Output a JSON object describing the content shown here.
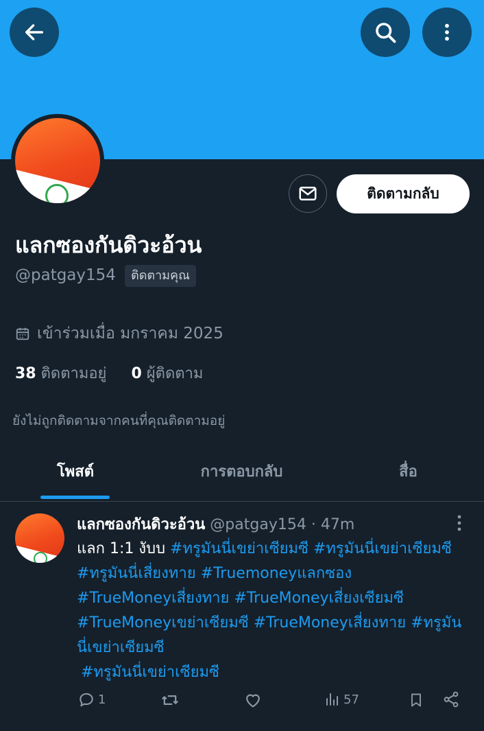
{
  "header": {
    "back": "back-arrow-icon",
    "search": "search-icon",
    "more": "more-vertical-icon"
  },
  "profile": {
    "display_name": "แลกซองกันดิวะอ้วน",
    "handle": "@patgay154",
    "follows_you_badge": "ติดตามคุณ",
    "joined": "เข้าร่วมเมื่อ มกราคม 2025",
    "following_count": "38",
    "following_label": "ติดตามอยู่",
    "followers_count": "0",
    "followers_label": "ผู้ติดตาม",
    "not_followed_note": "ยังไม่ถูกติดตามจากคนที่คุณติดตามอยู่",
    "follow_back_label": "ติดตามกลับ"
  },
  "tabs": [
    {
      "label": "โพสต์",
      "active": true
    },
    {
      "label": "การตอบกลับ",
      "active": false
    },
    {
      "label": "สื่อ",
      "active": false
    }
  ],
  "post": {
    "name": "แลกซองกันดิวะอ้วน",
    "handle": "@patgay154",
    "sep": "·",
    "time": "47m",
    "text_prefix": "แลก 1:1 งับบ",
    "tags": [
      "#ทรูมันนี่เขย่าเซียมซี",
      "#ทรูมันนี่เขย่าเซียมซี",
      "#ทรูมันนี่เสี่ยงทาย",
      "#Truemoneyแลกซอง",
      "#TrueMoneyเสี่ยงทาย",
      "#TrueMoneyเสี่ยงเซียมซี",
      "#TrueMoneyเขย่าเซียมซี",
      "#TrueMoneyเสี่ยงทาย",
      "#ทรูมันนี่เขย่าเซียมซี",
      "#ทรูมันนี่เขย่าเซียมซี"
    ],
    "replies": "1",
    "views": "57"
  },
  "colors": {
    "banner": "#1da1f2",
    "bg": "#15202b",
    "accent": "#1d9bf0",
    "muted": "#8b98a5"
  }
}
